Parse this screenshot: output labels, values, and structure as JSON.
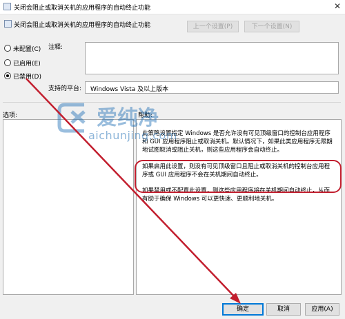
{
  "window": {
    "title": "关闭会阻止或取消关机的应用程序的自动终止功能",
    "close_glyph": "✕"
  },
  "header": {
    "policy_title": "关闭会阻止或取消关机的应用程序的自动终止功能",
    "prev_label": "上一个设置(P)",
    "next_label": "下一个设置(N)"
  },
  "options": [
    {
      "label": "未配置(C)",
      "selected": false
    },
    {
      "label": "已启用(E)",
      "selected": false
    },
    {
      "label": "已禁用(D)",
      "selected": true
    }
  ],
  "fields": {
    "comment_label": "注释:",
    "platform_label": "支持的平台:",
    "platform_value": "Windows Vista 及以上版本"
  },
  "panels": {
    "options_label": "选项:",
    "help_label": "帮助:"
  },
  "help_text": [
    "此策略设置指定 Windows 是否允许没有可见顶级窗口的控制台应用程序和 GUI 应用程序阻止或取消关机。默认情况下，如果此类应用程序无限期地试图取消或阻止关机，则这些应用程序会自动终止。",
    "如果启用此设置，则没有可见顶级窗口且阻止或取消关机的控制台应用程序或 GUI 应用程序不会在关机期间自动终止。",
    "如果禁用或不配置此设置，则这些应用程序将在关机期间自动终止，从而有助于确保 Windows 可以更快速、更顺利地关机。"
  ],
  "buttons": {
    "ok": "确定",
    "cancel": "取消",
    "apply": "应用(A)"
  },
  "watermark": {
    "text": "爱纯净",
    "url": "aichunjing.com"
  },
  "colors": {
    "annotation_red": "#c21e2e",
    "accent_blue": "#0078d7"
  }
}
